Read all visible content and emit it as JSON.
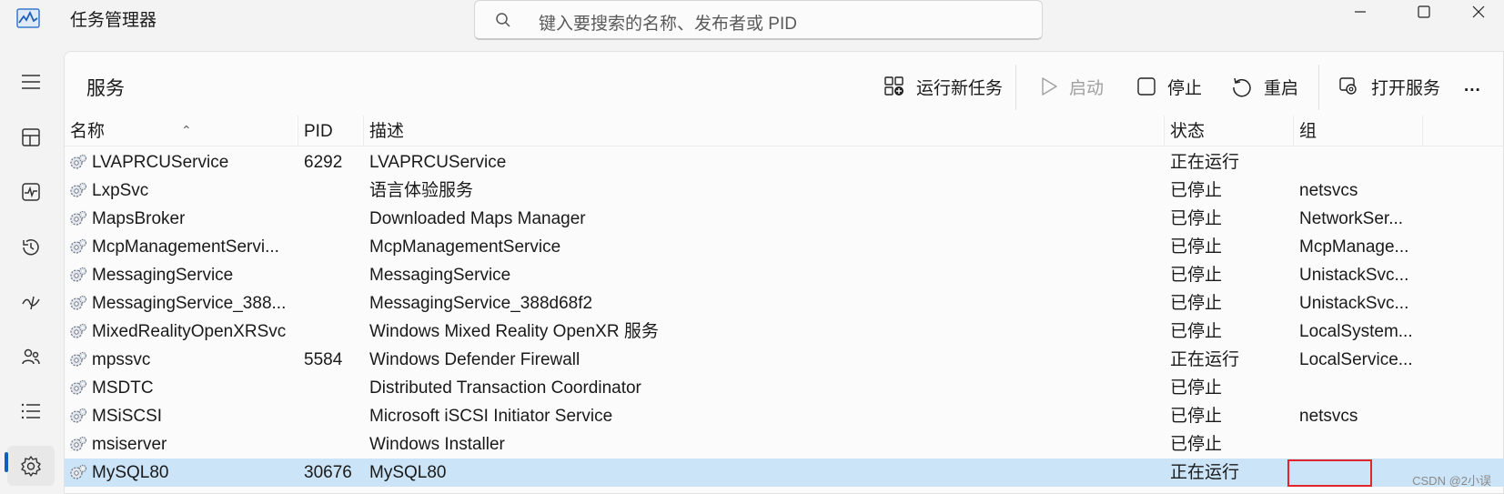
{
  "app": {
    "title": "任务管理器"
  },
  "search": {
    "placeholder": "键入要搜索的名称、发布者或 PID"
  },
  "sidebar": {
    "items": [
      {
        "name": "menu-icon"
      },
      {
        "name": "processes-icon"
      },
      {
        "name": "performance-icon"
      },
      {
        "name": "app-history-icon"
      },
      {
        "name": "startup-icon"
      },
      {
        "name": "users-icon"
      },
      {
        "name": "details-icon"
      },
      {
        "name": "services-icon",
        "active": true
      }
    ]
  },
  "page": {
    "title": "服务"
  },
  "toolbar": {
    "run_new_task": "运行新任务",
    "start": "启动",
    "stop": "停止",
    "restart": "重启",
    "open_services": "打开服务",
    "more": "..."
  },
  "table": {
    "headers": {
      "name": "名称",
      "pid": "PID",
      "description": "描述",
      "status": "状态",
      "group": "组"
    },
    "rows": [
      {
        "name": "LVAPRCUService",
        "pid": "6292",
        "description": "LVAPRCUService",
        "status": "正在运行",
        "group": ""
      },
      {
        "name": "LxpSvc",
        "pid": "",
        "description": "语言体验服务",
        "status": "已停止",
        "group": "netsvcs"
      },
      {
        "name": "MapsBroker",
        "pid": "",
        "description": "Downloaded Maps Manager",
        "status": "已停止",
        "group": "NetworkSer..."
      },
      {
        "name": "McpManagementServi...",
        "pid": "",
        "description": "McpManagementService",
        "status": "已停止",
        "group": "McpManage..."
      },
      {
        "name": "MessagingService",
        "pid": "",
        "description": "MessagingService",
        "status": "已停止",
        "group": "UnistackSvc..."
      },
      {
        "name": "MessagingService_388...",
        "pid": "",
        "description": "MessagingService_388d68f2",
        "status": "已停止",
        "group": "UnistackSvc..."
      },
      {
        "name": "MixedRealityOpenXRSvc",
        "pid": "",
        "description": "Windows Mixed Reality OpenXR 服务",
        "status": "已停止",
        "group": "LocalSystem..."
      },
      {
        "name": "mpssvc",
        "pid": "5584",
        "description": "Windows Defender Firewall",
        "status": "正在运行",
        "group": "LocalService..."
      },
      {
        "name": "MSDTC",
        "pid": "",
        "description": "Distributed Transaction Coordinator",
        "status": "已停止",
        "group": ""
      },
      {
        "name": "MSiSCSI",
        "pid": "",
        "description": "Microsoft iSCSI Initiator Service",
        "status": "已停止",
        "group": "netsvcs"
      },
      {
        "name": "msiserver",
        "pid": "",
        "description": "Windows Installer",
        "status": "已停止",
        "group": ""
      },
      {
        "name": "MySQL80",
        "pid": "30676",
        "description": "MySQL80",
        "status": "正在运行",
        "group": "",
        "selected": true
      }
    ]
  },
  "watermark": "CSDN @2小误",
  "colors": {
    "accent": "#0f5fbf",
    "selected_row": "#cce4f7",
    "highlight": "#e0262c"
  }
}
